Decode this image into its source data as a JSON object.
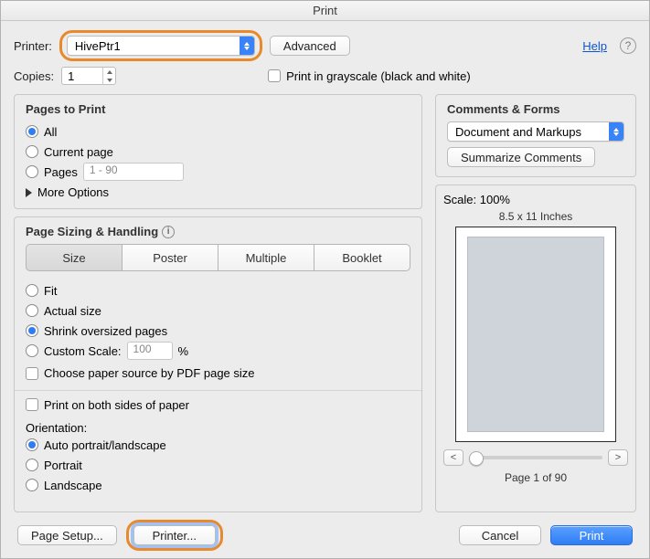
{
  "window": {
    "title": "Print"
  },
  "help": {
    "label": "Help"
  },
  "printer": {
    "label": "Printer:",
    "selected": "HivePtr1",
    "advanced": "Advanced"
  },
  "copies": {
    "label": "Copies:",
    "value": "1",
    "grayscale": "Print in grayscale (black and white)"
  },
  "pagesToPrint": {
    "title": "Pages to Print",
    "all": "All",
    "current": "Current page",
    "pages": "Pages",
    "range_placeholder": "1 - 90",
    "more": "More Options"
  },
  "sizing": {
    "title": "Page Sizing & Handling",
    "tabs": {
      "size": "Size",
      "poster": "Poster",
      "multiple": "Multiple",
      "booklet": "Booklet"
    },
    "fit": "Fit",
    "actual": "Actual size",
    "shrink": "Shrink oversized pages",
    "custom": "Custom Scale:",
    "custom_value": "100",
    "percent": "%",
    "choosePaper": "Choose paper source by PDF page size"
  },
  "duplex": {
    "bothSides": "Print on both sides of paper"
  },
  "orientation": {
    "title": "Orientation:",
    "auto": "Auto portrait/landscape",
    "portrait": "Portrait",
    "landscape": "Landscape"
  },
  "comments": {
    "title": "Comments & Forms",
    "selected": "Document and Markups",
    "summarize": "Summarize Comments"
  },
  "preview": {
    "scale": "Scale: 100%",
    "paper": "8.5 x 11 Inches",
    "prev": "<",
    "next": ">",
    "pageOf": "Page 1 of 90"
  },
  "footer": {
    "pageSetup": "Page Setup...",
    "printer": "Printer...",
    "cancel": "Cancel",
    "print": "Print"
  }
}
